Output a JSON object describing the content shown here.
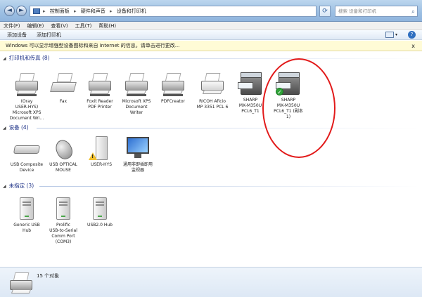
{
  "window": {
    "breadcrumb": [
      "控制面板",
      "硬件和声音",
      "设备和打印机"
    ],
    "search_placeholder": "搜索 设备和打印机"
  },
  "menu": [
    "文件(F)",
    "编辑(E)",
    "查看(V)",
    "工具(T)",
    "帮助(H)"
  ],
  "toolbar": {
    "add_device": "添加设备",
    "add_printer": "添加打印机"
  },
  "infobar": {
    "text": "Windows 可以显示增强型设备图标和来自 Internet 的信息。请单击进行更改...",
    "close": "x"
  },
  "groups": {
    "printers": {
      "title": "打印机和传真 (8)",
      "items": [
        {
          "label": "(Oray\nUSER-HYS)\nMicrosoft XPS\nDocument Wri..."
        },
        {
          "label": "Fax"
        },
        {
          "label": "Foxit Reader\nPDF Printer"
        },
        {
          "label": "Microsoft XPS\nDocument\nWriter"
        },
        {
          "label": "PDFCreator"
        },
        {
          "label": "RICOH Aficio\nMP 3351 PCL 6"
        },
        {
          "label": "SHARP\nMX-M350U\nPCL6_T1"
        },
        {
          "label": "SHARP\nMX-M350U\nPCL6_T1 (副本\n1)"
        }
      ]
    },
    "devices": {
      "title": "设备 (4)",
      "items": [
        {
          "label": "USB Composite\nDevice"
        },
        {
          "label": "USB OPTICAL\nMOUSE"
        },
        {
          "label": "USER-HYS"
        },
        {
          "label": "通用非即插即用\n监视器"
        }
      ]
    },
    "unspecified": {
      "title": "未指定 (3)",
      "items": [
        {
          "label": "Generic USB\nHub"
        },
        {
          "label": "Prolific\nUSB-to-Serial\nComm Port\n(COM3)"
        },
        {
          "label": "USB2.0 Hub"
        }
      ]
    }
  },
  "status": {
    "count": "15 个对象"
  },
  "colors": {
    "annotation_circle": "#e21b1b",
    "group_header": "#1e3287",
    "default_check": "#2fa338"
  }
}
